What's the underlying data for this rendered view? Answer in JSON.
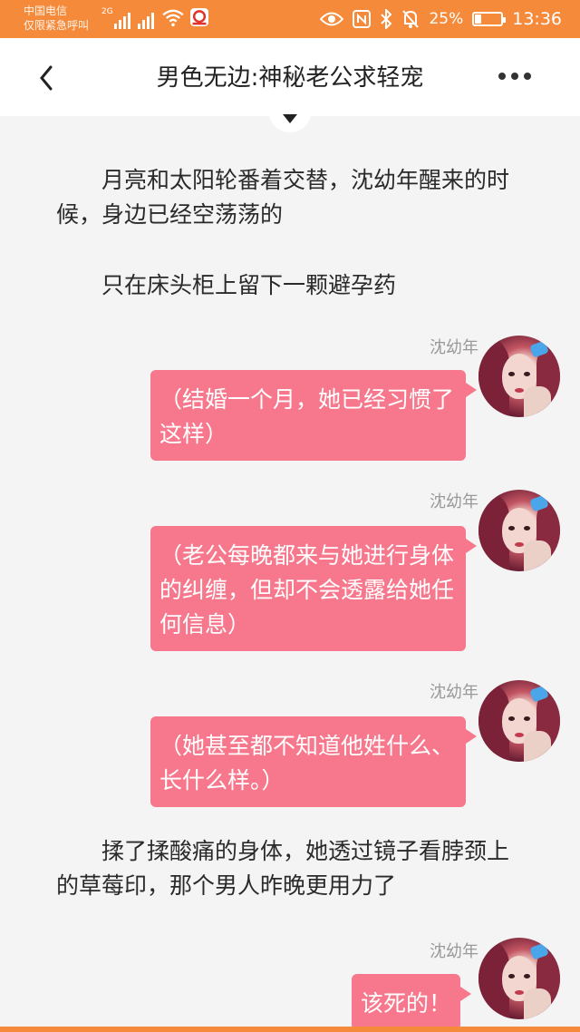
{
  "status_bar": {
    "carrier_line1": "中国电信",
    "carrier_line2": "仅限紧急呼叫",
    "network": "2G",
    "battery_percent": "25%",
    "battery_level": 0.25,
    "time": "13:36"
  },
  "header": {
    "title": "男色无边:神秘老公求轻宠"
  },
  "story": {
    "para1": "月亮和太阳轮番着交替，沈幼年醒来的时候，身边已经空荡荡的",
    "para2": "只在床头柜上留下一颗避孕药",
    "messages": [
      {
        "name": "沈幼年",
        "text": "（结婚一个月，她已经习惯了这样）"
      },
      {
        "name": "沈幼年",
        "text": "（老公每晚都来与她进行身体的纠缠，但却不会透露给她任何信息）"
      },
      {
        "name": "沈幼年",
        "text": "（她甚至都不知道他姓什么、长什么样。）"
      }
    ],
    "para3": "揉了揉酸痛的身体，她透过镜子看脖颈上的草莓印，那个男人昨晚更用力了",
    "last_message": {
      "name": "沈幼年",
      "text": "该死的！"
    }
  },
  "colors": {
    "status_bar": "#f58a3a",
    "bubble": "#f7788c",
    "background": "#f4f4f4"
  }
}
